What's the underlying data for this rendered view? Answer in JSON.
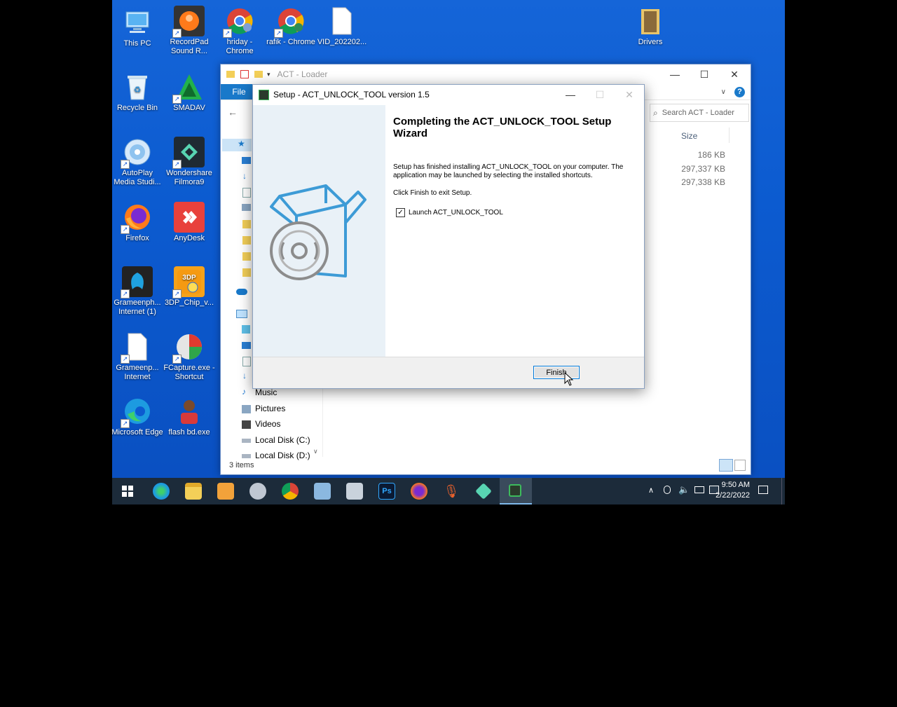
{
  "desktop": {
    "icons": [
      {
        "label": "This PC"
      },
      {
        "label": "RecordPad Sound R..."
      },
      {
        "label": "hriday - Chrome"
      },
      {
        "label": "rafik - Chrome"
      },
      {
        "label": "VID_202202..."
      },
      {
        "label": "Drivers"
      },
      {
        "label": "Recycle Bin"
      },
      {
        "label": "SMADAV"
      },
      {
        "label": "AutoPlay Media Studi..."
      },
      {
        "label": "Wondershare Filmora9"
      },
      {
        "label": "Firefox"
      },
      {
        "label": "AnyDesk"
      },
      {
        "label": "Grameenph... Internet (1)"
      },
      {
        "label": "3DP_Chip_v..."
      },
      {
        "label": "Grameenp... Internet"
      },
      {
        "label": "FCapture.exe - Shortcut"
      },
      {
        "label": "Microsoft Edge"
      },
      {
        "label": "flash bd.exe"
      }
    ]
  },
  "explorer": {
    "title": "ACT - Loader",
    "ribbon_tab": "File",
    "search_placeholder": "Search ACT - Loader",
    "column_size": "Size",
    "sizes": [
      "186 KB",
      "297,337 KB",
      "297,338 KB"
    ],
    "nav_items": [
      "Music",
      "Pictures",
      "Videos",
      "Local Disk (C:)",
      "Local Disk (D:)"
    ],
    "status": "3 items"
  },
  "dialog": {
    "title": "Setup - ACT_UNLOCK_TOOL version 1.5",
    "heading": "Completing the ACT_UNLOCK_TOOL Setup Wizard",
    "body1": "Setup has finished installing ACT_UNLOCK_TOOL on your computer. The application may be launched by selecting the installed shortcuts.",
    "body2": "Click Finish to exit Setup.",
    "checkbox_label": "Launch ACT_UNLOCK_TOOL",
    "checkbox_checked": true,
    "finish_label": "Finish"
  },
  "taskbar": {
    "time": "9:50 AM",
    "date": "2/22/2022"
  },
  "colors": {
    "desktop": "#0c5bd0",
    "accent": "#0078d7",
    "taskbar": "#1c2b3a"
  }
}
